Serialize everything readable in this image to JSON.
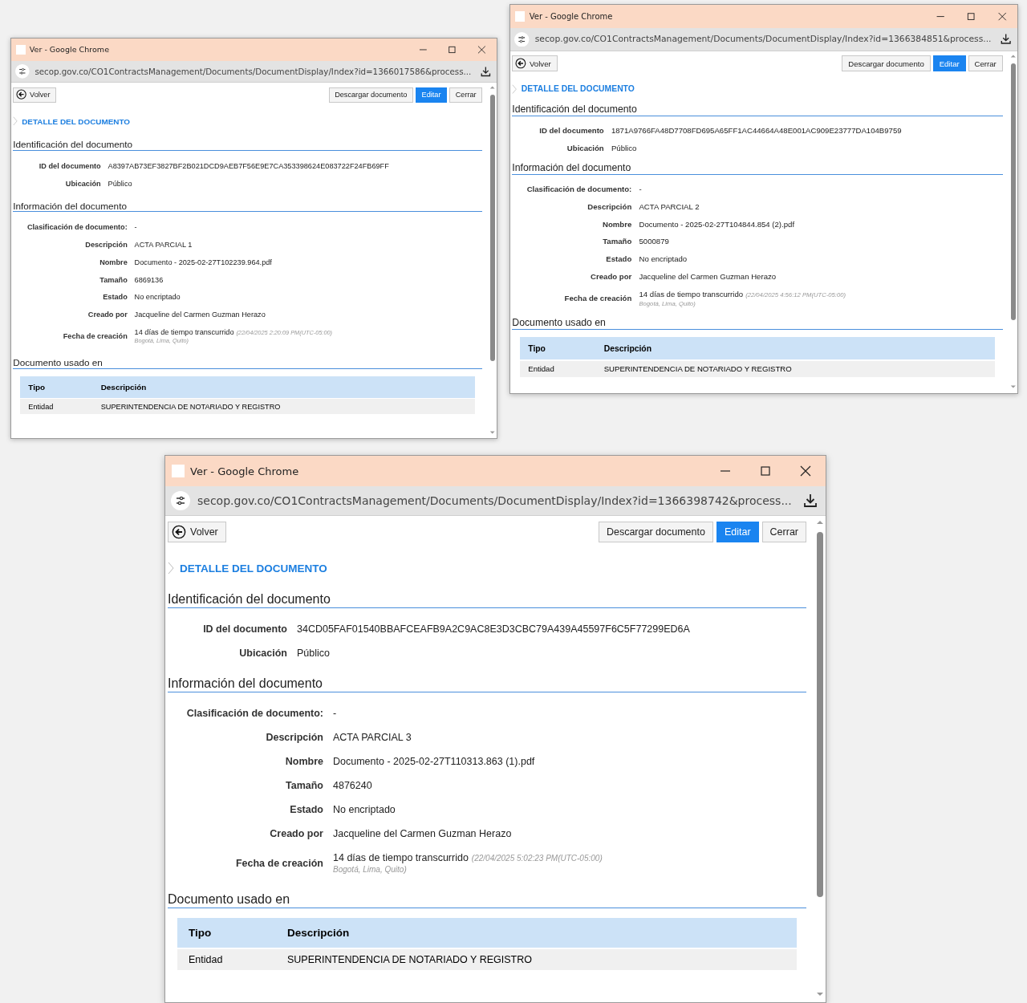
{
  "windows": [
    {
      "title": "Ver - Google Chrome",
      "url": "secop.gov.co/CO1ContractsManagement/Documents/DocumentDisplay/Index?id=1366017586&process...",
      "back": "Volver",
      "actions": [
        {
          "label": "Descargar documento",
          "primary": false
        },
        {
          "label": "Editar",
          "primary": true
        },
        {
          "label": "Cerrar",
          "primary": false
        }
      ],
      "breadcrumb": "DETALLE DEL DOCUMENTO",
      "sections": [
        {
          "title": "Identificación del documento",
          "fields": [
            {
              "label": "ID del documento",
              "value": "A8397AB73EF3827BF2B021DCD9AEB7F56E9E7CA353398624E083722F24FB69FF"
            },
            {
              "label": "Ubicación",
              "value": "Público"
            }
          ]
        },
        {
          "title": "Información del documento",
          "fields": [
            {
              "label": "Clasificación de documento:",
              "value": "-"
            },
            {
              "label": "Descripción",
              "value": "ACTA PARCIAL 1"
            },
            {
              "label": "Nombre",
              "value": "Documento - 2025-02-27T102239.964.pdf"
            },
            {
              "label": "Tamaño",
              "value": "6869136"
            },
            {
              "label": "Estado",
              "value": "No encriptado"
            },
            {
              "label": "Creado por",
              "value": "Jacqueline del Carmen Guzman Herazo"
            },
            {
              "label": "Fecha de creación",
              "value": "14 días de tiempo transcurrido",
              "note": "(22/04/2025 2:20:09 PM(UTC-05:00) Bogotá, Lima, Quito)"
            }
          ]
        }
      ],
      "usage": {
        "title": "Documento usado en",
        "columns": [
          "Tipo",
          "Descripción"
        ],
        "rows": [
          [
            "Entidad",
            "SUPERINTENDENCIA DE NOTARIADO Y REGISTRO"
          ]
        ]
      }
    },
    {
      "title": "Ver - Google Chrome",
      "url": "secop.gov.co/CO1ContractsManagement/Documents/DocumentDisplay/Index?id=1366384851&process...",
      "back": "Volver",
      "actions": [
        {
          "label": "Descargar documento",
          "primary": false
        },
        {
          "label": "Editar",
          "primary": true
        },
        {
          "label": "Cerrar",
          "primary": false
        }
      ],
      "breadcrumb": "DETALLE DEL DOCUMENTO",
      "sections": [
        {
          "title": "Identificación del documento",
          "fields": [
            {
              "label": "ID del documento",
              "value": "1871A9766FA48D7708FD695A65FF1AC44664A48E001AC909E23777DA104B9759"
            },
            {
              "label": "Ubicación",
              "value": "Público"
            }
          ]
        },
        {
          "title": "Información del documento",
          "fields": [
            {
              "label": "Clasificación de documento:",
              "value": "-"
            },
            {
              "label": "Descripción",
              "value": "ACTA PARCIAL 2"
            },
            {
              "label": "Nombre",
              "value": "Documento - 2025-02-27T104844.854 (2).pdf"
            },
            {
              "label": "Tamaño",
              "value": "5000879"
            },
            {
              "label": "Estado",
              "value": "No encriptado"
            },
            {
              "label": "Creado por",
              "value": "Jacqueline del Carmen Guzman Herazo"
            },
            {
              "label": "Fecha de creación",
              "value": "14 días de tiempo transcurrido",
              "note": "(22/04/2025 4:56:12 PM(UTC-05:00) Bogotá, Lima, Quito)"
            }
          ]
        }
      ],
      "usage": {
        "title": "Documento usado en",
        "columns": [
          "Tipo",
          "Descripción"
        ],
        "rows": [
          [
            "Entidad",
            "SUPERINTENDENCIA DE NOTARIADO Y REGISTRO"
          ]
        ]
      }
    },
    {
      "title": "Ver - Google Chrome",
      "url": "secop.gov.co/CO1ContractsManagement/Documents/DocumentDisplay/Index?id=1366398742&process...",
      "back": "Volver",
      "actions": [
        {
          "label": "Descargar documento",
          "primary": false
        },
        {
          "label": "Editar",
          "primary": true
        },
        {
          "label": "Cerrar",
          "primary": false
        }
      ],
      "breadcrumb": "DETALLE DEL DOCUMENTO",
      "sections": [
        {
          "title": "Identificación del documento",
          "fields": [
            {
              "label": "ID del documento",
              "value": "34CD05FAF01540BBAFCEAFB9A2C9AC8E3D3CBC79A439A45597F6C5F77299ED6A"
            },
            {
              "label": "Ubicación",
              "value": "Público"
            }
          ]
        },
        {
          "title": "Información del documento",
          "fields": [
            {
              "label": "Clasificación de documento:",
              "value": "-"
            },
            {
              "label": "Descripción",
              "value": "ACTA PARCIAL 3"
            },
            {
              "label": "Nombre",
              "value": "Documento - 2025-02-27T110313.863 (1).pdf"
            },
            {
              "label": "Tamaño",
              "value": "4876240"
            },
            {
              "label": "Estado",
              "value": "No encriptado"
            },
            {
              "label": "Creado por",
              "value": "Jacqueline del Carmen Guzman Herazo"
            },
            {
              "label": "Fecha de creación",
              "value": "14 días de tiempo transcurrido",
              "note": "(22/04/2025 5:02:23 PM(UTC-05:00) Bogotá, Lima, Quito)"
            }
          ]
        }
      ],
      "usage": {
        "title": "Documento usado en",
        "columns": [
          "Tipo",
          "Descripción"
        ],
        "rows": [
          [
            "Entidad",
            "SUPERINTENDENCIA DE NOTARIADO Y REGISTRO"
          ]
        ]
      }
    }
  ]
}
